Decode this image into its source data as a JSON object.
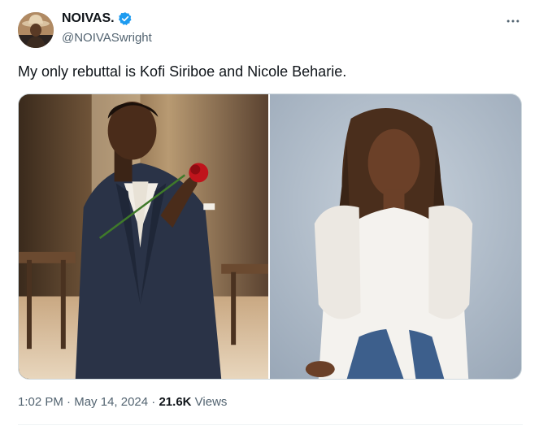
{
  "author": {
    "display_name": "NOIVAS.",
    "handle": "@NOIVASwright",
    "verified": true
  },
  "tweet": {
    "text": "My only rebuttal is Kofi Siriboe and Nicole Beharie."
  },
  "media": {
    "photo_count": 2
  },
  "meta": {
    "time": "1:02 PM",
    "separator": "·",
    "date": "May 14, 2024",
    "views_count": "21.6K",
    "views_label": "Views"
  },
  "icons": {
    "verified": "verified-badge-icon",
    "more": "more-options-icon"
  },
  "colors": {
    "verified_blue": "#1d9bf0",
    "text_primary": "#0f1419",
    "text_secondary": "#536471"
  }
}
